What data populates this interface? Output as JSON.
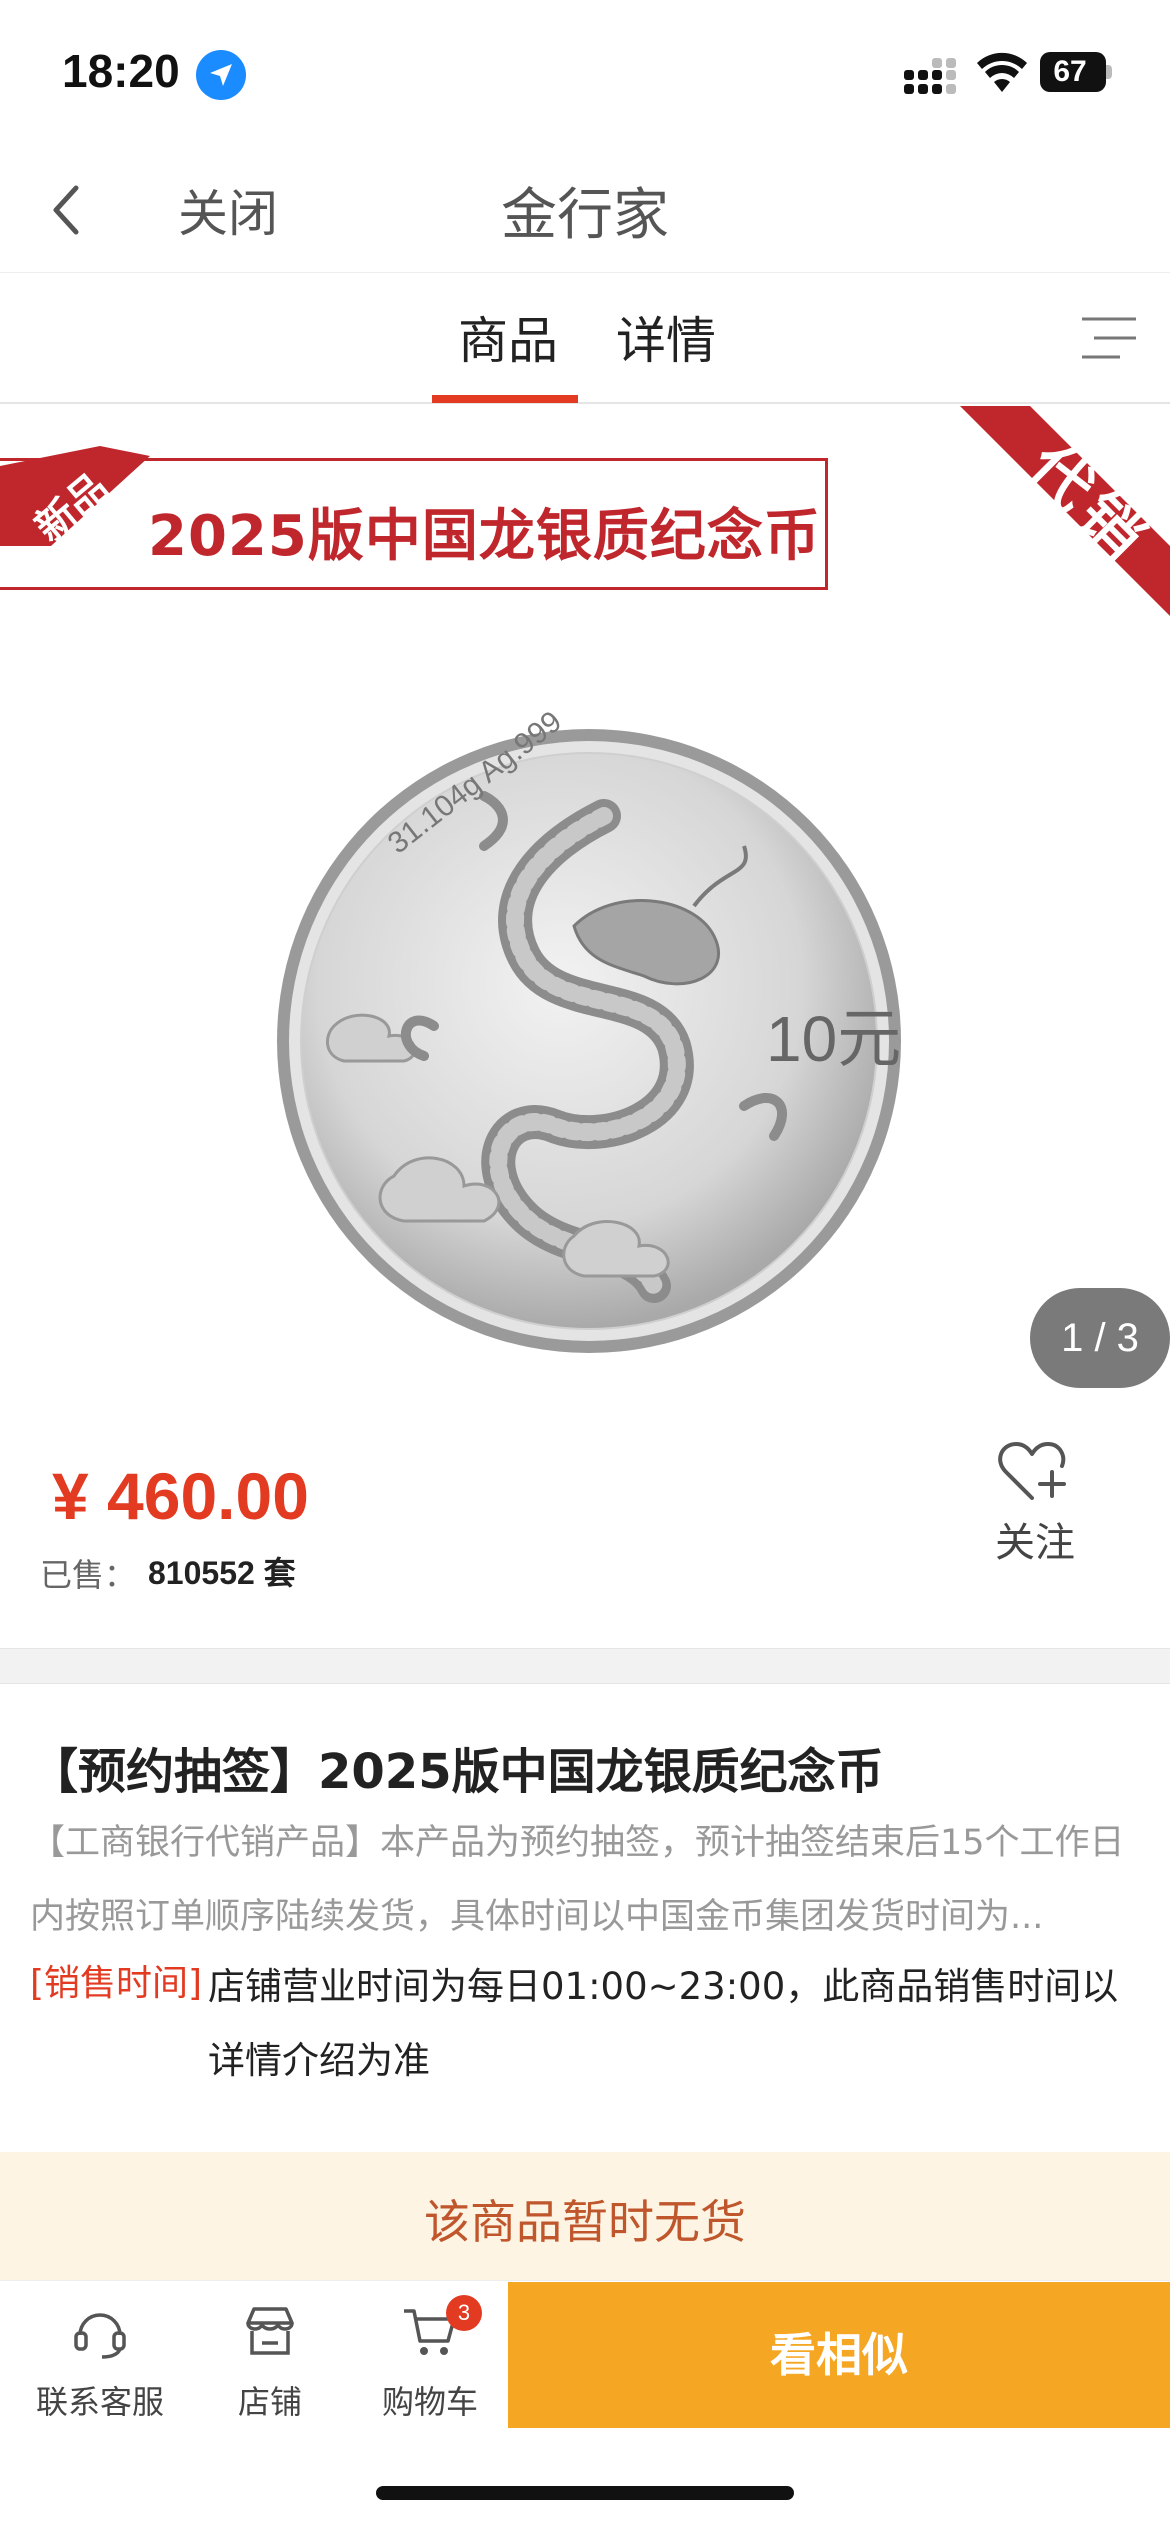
{
  "status_bar": {
    "time": "18:20",
    "battery": "67"
  },
  "nav": {
    "close_label": "关闭",
    "title": "金行家"
  },
  "tabs": [
    {
      "label": "商品",
      "active": true
    },
    {
      "label": "详情",
      "active": false
    }
  ],
  "product_image": {
    "banner_title": "2025版中国龙银质纪念币",
    "new_tag": "新品",
    "corner_ribbon": "代销",
    "coin_inscription": "31.104g Ag.999",
    "coin_denomination": "10元",
    "counter": "1 / 3"
  },
  "price": {
    "value": "¥ 460.00",
    "sold_label": "已售：",
    "sold_value": "810552 套"
  },
  "follow": {
    "label": "关注",
    "icon": "heart-plus-icon"
  },
  "description": {
    "title": "【预约抽签】2025版中国龙银质纪念币",
    "text": "【工商银行代销产品】本产品为预约抽签，预计抽签结束后15个工作日内按照订单顺序陆续发货，具体时间以中国金币集团发货时间为...",
    "sale_time_label": "[销售时间]",
    "sale_time_text": "店铺营业时间为每日01:00~23:00，此商品销售时间以详情介绍为准"
  },
  "notice": {
    "text": "该商品暂时无货"
  },
  "toolbar": {
    "service_label": "联系客服",
    "shop_label": "店铺",
    "cart_label": "购物车",
    "cart_count": "3",
    "similar_button": "看相似"
  },
  "colors": {
    "accent": "#e23b22",
    "banner_red": "#c0272d",
    "button_orange": "#f5a623",
    "notice_bg": "#fdf4e3"
  }
}
